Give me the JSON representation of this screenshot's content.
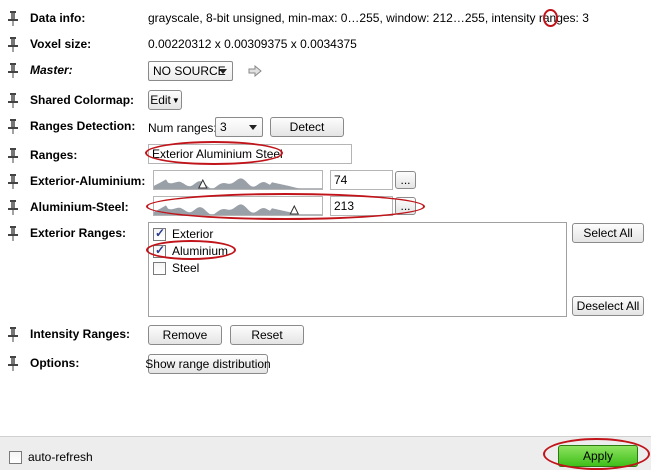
{
  "rows": {
    "data_info": {
      "label": "Data info:",
      "value": "grayscale, 8-bit unsigned, min-max: 0…255, window: 212…255, intensity ranges: ",
      "ranges_count": "3"
    },
    "voxel_size": {
      "label": "Voxel size:",
      "value": "0.00220312 x 0.00309375 x 0.0034375"
    },
    "master": {
      "label": "Master:",
      "selected": "NO SOURCE"
    },
    "shared_colormap": {
      "label": "Shared Colormap:",
      "button": "Edit"
    },
    "ranges_detection": {
      "label": "Ranges Detection:",
      "num_label": "Num ranges:",
      "num_value": "3",
      "detect_button": "Detect"
    },
    "ranges": {
      "label": "Ranges:",
      "value": "Exterior Aluminium Steel"
    },
    "exterior_aluminium": {
      "label": "Exterior-Aluminium:",
      "threshold": "74",
      "more_button": "..."
    },
    "aluminium_steel": {
      "label": "Aluminium-Steel:",
      "threshold": "213",
      "more_button": "..."
    },
    "exterior_ranges": {
      "label": "Exterior Ranges:",
      "items": [
        {
          "label": "Exterior",
          "checked": true
        },
        {
          "label": "Aluminium",
          "checked": true
        },
        {
          "label": "Steel",
          "checked": false
        }
      ],
      "select_all": "Select All",
      "deselect_all": "Deselect All"
    },
    "intensity_ranges": {
      "label": "Intensity Ranges:",
      "remove_button": "Remove",
      "reset_button": "Reset"
    },
    "options": {
      "label": "Options:",
      "button": "Show range distribution"
    }
  },
  "footer": {
    "auto_refresh_label": "auto-refresh",
    "auto_refresh_checked": false,
    "apply_label": "Apply"
  },
  "histogram": {
    "exterior_aluminium_marker": 74,
    "aluminium_steel_marker": 213,
    "max": 255
  },
  "colors": {
    "annotation_red": "#c0141a",
    "apply_green": "#3fbf1a",
    "hist_fill": "#9aa0a8"
  }
}
